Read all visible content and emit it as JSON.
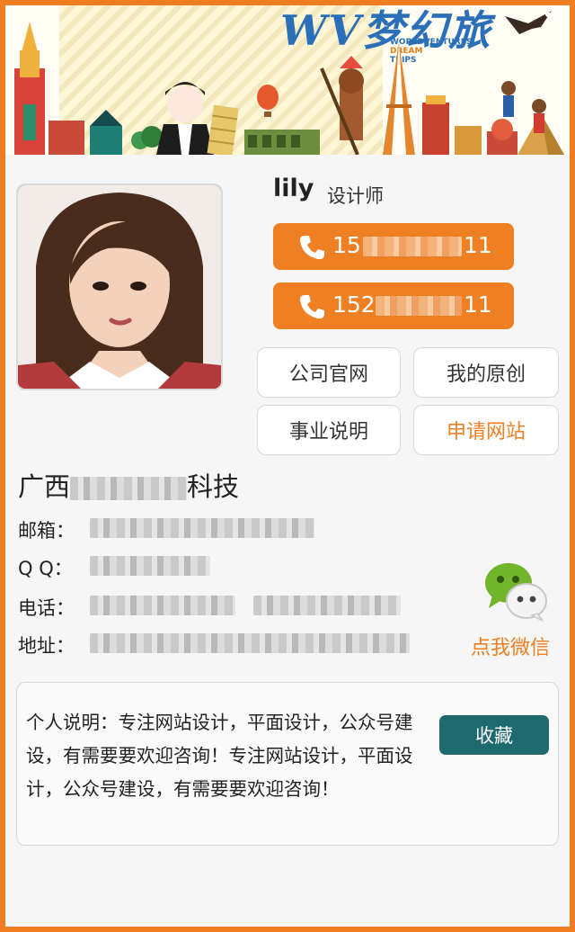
{
  "banner": {
    "title": "WV梦幻旅",
    "subtitle_line1": "WORLDVENTURES",
    "subtitle_line2": "DREAM",
    "subtitle_line3": "TRIPS"
  },
  "profile": {
    "name": "lily",
    "role": "设计师",
    "phone1_prefix": "15",
    "phone1_suffix": "11",
    "phone2_prefix": "152",
    "phone2_suffix": "11"
  },
  "links": {
    "official_site": "公司官网",
    "my_original": "我的原创",
    "business_intro": "事业说明",
    "apply_site": "申请网站"
  },
  "company": {
    "name_prefix": "广西",
    "name_suffix": "科技"
  },
  "info": {
    "email_label": "邮箱：",
    "qq_label": "Q Q：",
    "phone_label": "电话：",
    "address_label": "地址："
  },
  "wechat": {
    "label": "点我微信"
  },
  "personal": {
    "description": "个人说明：专注网站设计，平面设计，公众号建设，有需要要欢迎咨询！专注网站设计，平面设计，公众号建设，有需要要欢迎咨询！",
    "favorite_label": "收藏"
  },
  "colors": {
    "accent": "#ef7f23",
    "favorite_button": "#1f6a6e",
    "banner_title": "#2a6fb8"
  },
  "icons": [
    "phone-icon",
    "wechat-icon"
  ]
}
